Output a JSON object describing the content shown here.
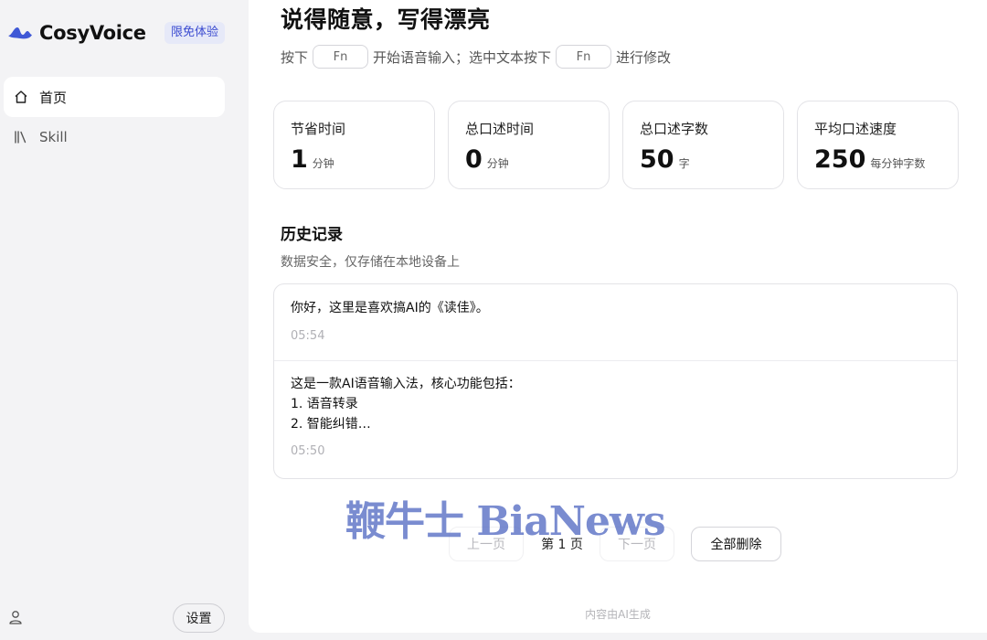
{
  "app": {
    "name": "CosyVoice",
    "badge": "限免体验"
  },
  "sidebar": {
    "items": [
      {
        "label": "首页",
        "icon": "home-icon",
        "active": true
      },
      {
        "label": "Skill",
        "icon": "library-icon",
        "active": false
      }
    ],
    "settings_label": "设置",
    "user_icon": "user-icon"
  },
  "header": {
    "title": "说得随意，写得漂亮",
    "hint": {
      "part1": "按下",
      "key1": "Fn",
      "part2": "开始语音输入；选中文本按下",
      "key2": "Fn",
      "part3": "进行修改"
    }
  },
  "stats": [
    {
      "label": "节省时间",
      "value": "1",
      "unit": "分钟"
    },
    {
      "label": "总口述时间",
      "value": "0",
      "unit": "分钟"
    },
    {
      "label": "总口述字数",
      "value": "50",
      "unit": "字"
    },
    {
      "label": "平均口述速度",
      "value": "250",
      "unit": "每分钟字数"
    }
  ],
  "history": {
    "title": "历史记录",
    "subtitle": "数据安全，仅存储在本地设备上",
    "items": [
      {
        "text": "你好，这里是喜欢搞AI的《读佳》。",
        "time": "05:54"
      },
      {
        "text": "这是一款AI语音输入法，核心功能包括：\n1. 语音转录\n2. 智能纠错…",
        "time": "05:50"
      }
    ]
  },
  "pagination": {
    "prev_label": "上一页",
    "page_label": "第 1 页",
    "next_label": "下一页",
    "delete_all_label": "全部删除"
  },
  "footer_note": "内容由AI生成",
  "watermark": "鞭牛士 BiaNews",
  "colors": {
    "accent": "#3b4bd0",
    "logo": "#3f58d6",
    "background": "#f3f3f5"
  }
}
